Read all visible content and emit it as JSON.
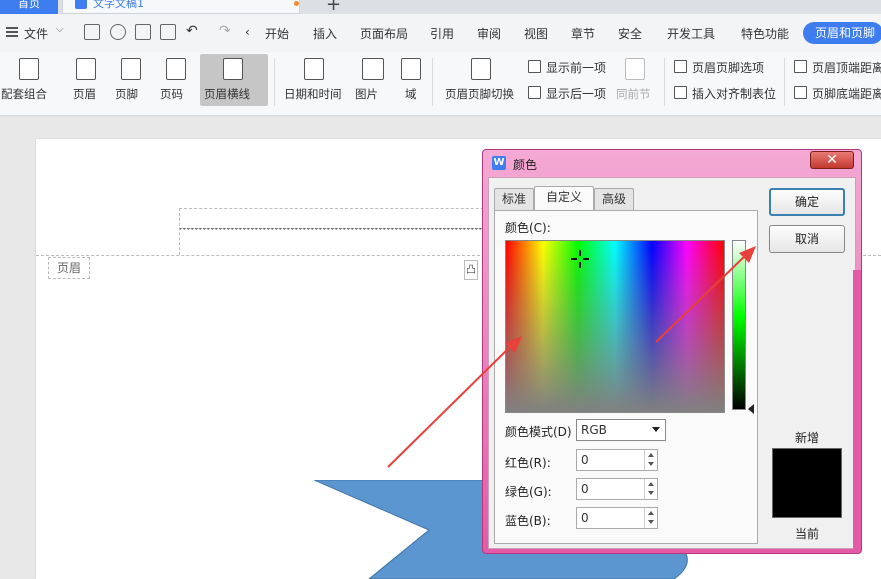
{
  "top_tabs": {
    "home": "首页",
    "doc": "文字文稿1"
  },
  "menu": {
    "file": "文件",
    "items": [
      "开始",
      "插入",
      "页面布局",
      "引用",
      "审阅",
      "视图",
      "章节",
      "安全",
      "开发工具",
      "特色功能"
    ],
    "active": "页眉和页脚"
  },
  "ribbon": {
    "buttons": [
      "配套组合",
      "页眉",
      "页脚",
      "页码",
      "页眉横线",
      "日期和时间",
      "图片",
      "域",
      "页眉页脚切换"
    ],
    "small": [
      "显示前一项",
      "显示后一项",
      "同前节",
      "页眉页脚选项",
      "插入对齐制表位",
      "页眉顶端距离",
      "页脚底端距离"
    ]
  },
  "document": {
    "header_tag": "页眉",
    "mini_tag": "凸"
  },
  "dialog": {
    "title": "颜色",
    "close": "✕",
    "tabs": [
      "标准",
      "自定义",
      "高级"
    ],
    "active_tab": "自定义",
    "color_label": "颜色(C):",
    "mode_label": "颜色模式(D)",
    "mode_value": "RGB",
    "red_label": "红色(R):",
    "green_label": "绿色(G):",
    "blue_label": "蓝色(B):",
    "red": "0",
    "green": "0",
    "blue": "0",
    "ok": "确定",
    "cancel": "取消",
    "new_label": "新增",
    "current_label": "当前",
    "preview_color": "#000000"
  },
  "colors": {
    "accent": "#3d7df0",
    "dialog_frame": "#e45aa7",
    "shape": "#5b96d0",
    "arrow": "#e8403a"
  }
}
